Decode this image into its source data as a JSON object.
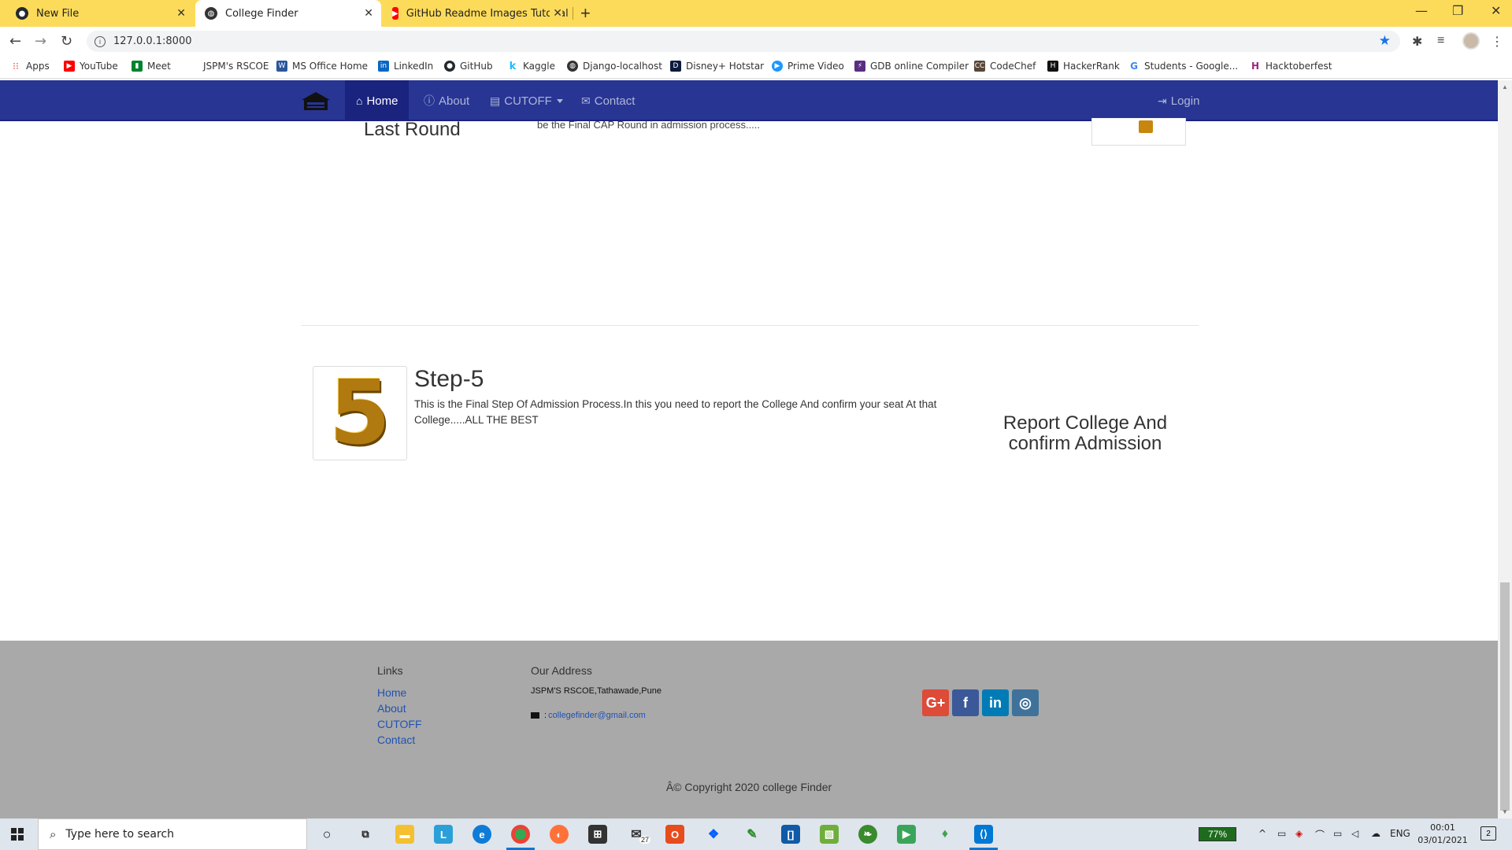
{
  "browser": {
    "tabs": [
      {
        "title": "New File",
        "icon": "github-icon"
      },
      {
        "title": "College Finder",
        "icon": "globe-icon"
      },
      {
        "title": "GitHub Readme Images Tutorial",
        "icon": "youtube-icon"
      }
    ],
    "url": "127.0.0.1:8000",
    "bookmarks": [
      {
        "label": "Apps",
        "icon": "apps-grid-icon",
        "color": "#e53935"
      },
      {
        "label": "YouTube",
        "icon": "youtube-icon",
        "color": "#ff0000"
      },
      {
        "label": "Meet",
        "icon": "meet-icon",
        "color": "#00832d"
      },
      {
        "label": "JSPM's RSCOE",
        "icon": "",
        "color": "#ffffff"
      },
      {
        "label": "MS Office Home",
        "icon": "word-icon",
        "color": "#2b579a"
      },
      {
        "label": "LinkedIn",
        "icon": "linkedin-icon",
        "color": "#0a66c2"
      },
      {
        "label": "GitHub",
        "icon": "github-icon",
        "color": "#24292e"
      },
      {
        "label": "Kaggle",
        "icon": "kaggle-icon",
        "color": "#20beff"
      },
      {
        "label": "Django-localhost",
        "icon": "globe-icon",
        "color": "#333333"
      },
      {
        "label": "Disney+ Hotstar",
        "icon": "hotstar-icon",
        "color": "#0c1a3d"
      },
      {
        "label": "Prime Video",
        "icon": "prime-video-icon",
        "color": "#1a98ff"
      },
      {
        "label": "GDB online Compiler",
        "icon": "gdb-icon",
        "color": "#5a2d82"
      },
      {
        "label": "CodeChef",
        "icon": "codechef-icon",
        "color": "#5b4638"
      },
      {
        "label": "HackerRank",
        "icon": "hackerrank-icon",
        "color": "#111111"
      },
      {
        "label": "Students - Google...",
        "icon": "google-icon",
        "color": "#4285f4"
      },
      {
        "label": "Hacktoberfest",
        "icon": "hacktoberfest-icon",
        "color": "#9c2780"
      }
    ]
  },
  "navbar": {
    "items": [
      {
        "label": "Home",
        "icon": "home-icon"
      },
      {
        "label": "About",
        "icon": "info-icon"
      },
      {
        "label": "CUTOFF",
        "icon": "list-icon"
      },
      {
        "label": "Contact",
        "icon": "envelope-icon"
      }
    ],
    "login_label": "Login",
    "color": "#283593"
  },
  "step4": {
    "title": "Last Round",
    "text_fragment": "be the Final CAP Round in admission process....."
  },
  "step5": {
    "numeral": "5",
    "title": "Step-5",
    "description": "This is the Final Step Of Admission Process.In this you need to report the College And confirm your seat At that College.....ALL THE BEST",
    "side_heading": "Report College And confirm Admission"
  },
  "footer": {
    "links_heading": "Links",
    "links": [
      "Home",
      "About",
      "CUTOFF",
      "Contact"
    ],
    "address_heading": "Our Address",
    "address": "JSPM'S RSCOE,Tathawade,Pune",
    "email": "collegefinder@gmail.com",
    "social": [
      {
        "name": "google-plus",
        "glyph": "G+",
        "color": "#dd4b39"
      },
      {
        "name": "facebook",
        "glyph": "f",
        "color": "#3b5998"
      },
      {
        "name": "linkedin",
        "glyph": "in",
        "color": "#007bb6"
      },
      {
        "name": "instagram",
        "glyph": "◎",
        "color": "#3f729b"
      }
    ],
    "copyright": "Â© Copyright 2020 college Finder"
  },
  "taskbar": {
    "search_placeholder": "Type here to search",
    "battery": "77%",
    "language": "ENG",
    "time": "00:01",
    "date": "03/01/2021",
    "mail_badge": "27",
    "notifications": "2"
  }
}
